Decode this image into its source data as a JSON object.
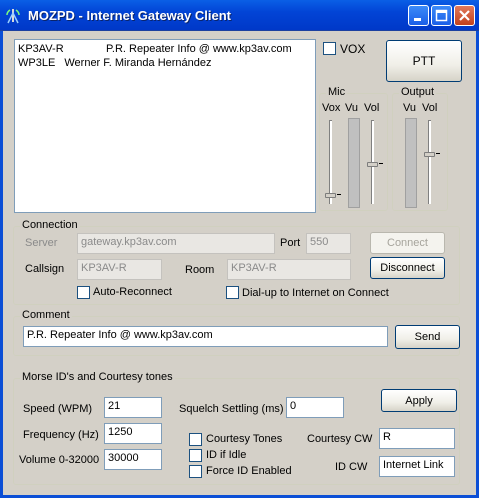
{
  "window": {
    "title": "MOZPD - Internet Gateway Client"
  },
  "list": {
    "rows": [
      {
        "callsign": "KP3AV-R",
        "description": "P.R. Repeater   Info @ www.kp3av.com"
      },
      {
        "callsign": "WP3LE",
        "description": "Werner F. Miranda Hernández"
      }
    ]
  },
  "audio": {
    "vox_label": "VOX",
    "vox_checked": false,
    "ptt_label": "PTT",
    "mic_label": "Mic",
    "mic_vox_label": "Vox",
    "mic_vu_label": "Vu",
    "mic_vol_label": "Vol",
    "output_label": "Output",
    "out_vu_label": "Vu",
    "out_vol_label": "Vol"
  },
  "connection": {
    "group_label": "Connection",
    "server_label": "Server",
    "server_value": "gateway.kp3av.com",
    "port_label": "Port",
    "port_value": "550",
    "callsign_label": "Callsign",
    "callsign_value": "KP3AV-R",
    "room_label": "Room",
    "room_value": "KP3AV-R",
    "connect_label": "Connect",
    "disconnect_label": "Disconnect",
    "auto_reconnect_label": "Auto-Reconnect",
    "auto_reconnect_checked": false,
    "dialup_label": "Dial-up to Internet on Connect",
    "dialup_checked": false
  },
  "comment": {
    "group_label": "Comment",
    "value": "P.R. Repeater   Info @ www.kp3av.com",
    "send_label": "Send"
  },
  "morse": {
    "group_label": "Morse ID's and Courtesy tones",
    "speed_label": "Speed (WPM)",
    "speed_value": "21",
    "frequency_label": "Frequency (Hz)",
    "frequency_value": "1250",
    "volume_label": "Volume 0-32000",
    "volume_value": "30000",
    "squelch_label": "Squelch Settling (ms)",
    "squelch_value": "0",
    "apply_label": "Apply",
    "courtesy_tones_label": "Courtesy Tones",
    "id_if_idle_label": "ID if Idle",
    "force_id_label": "Force ID Enabled",
    "courtesy_cw_label": "Courtesy CW",
    "courtesy_cw_value": "R",
    "id_cw_label": "ID CW",
    "id_cw_value": "Internet Link"
  }
}
